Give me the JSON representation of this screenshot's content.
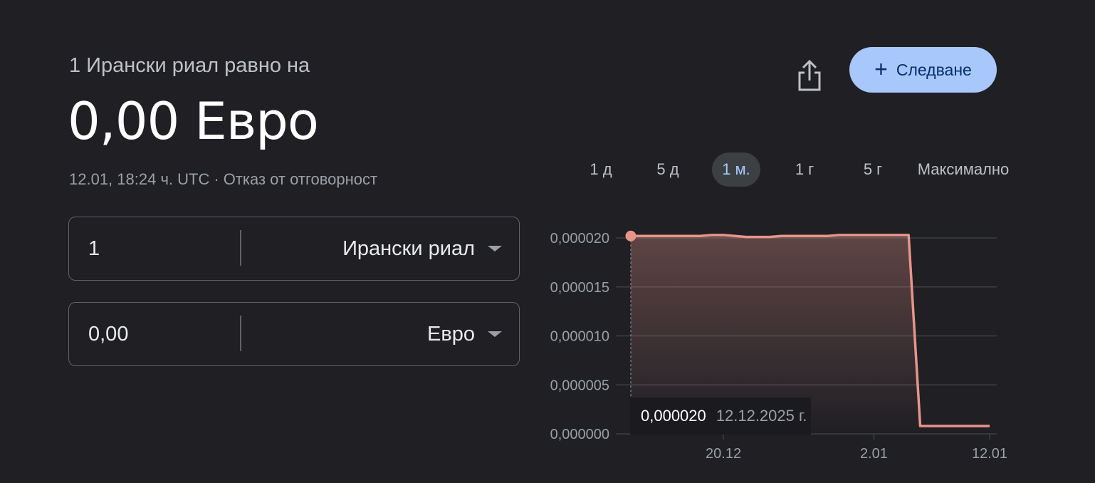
{
  "header": {
    "subtitle": "1 Ирански риал равно на",
    "value": "0,00 Евро",
    "timestamp": "12.01, 18:24 ч. UTC",
    "separator": "·",
    "disclaimer": "Отказ от отговорност"
  },
  "actions": {
    "share_icon": "share-icon",
    "follow_label": "Следване",
    "follow_icon": "plus-icon",
    "follow_bg": "#a8c7fa"
  },
  "converter": {
    "from": {
      "amount": "1",
      "currency": "Ирански риал"
    },
    "to": {
      "amount": "0,00",
      "currency": "Евро"
    }
  },
  "ranges": {
    "items": [
      "1 д",
      "5 д",
      "1 м.",
      "1 г",
      "5 г",
      "Максимално"
    ],
    "active": "1 м."
  },
  "chart_data": {
    "type": "area",
    "line_color": "#e8948a",
    "x": [
      "12.12",
      "13.12",
      "14.12",
      "15.12",
      "16.12",
      "17.12",
      "18.12",
      "19.12",
      "20.12",
      "21.12",
      "22.12",
      "23.12",
      "24.12",
      "25.12",
      "26.12",
      "27.12",
      "28.12",
      "29.12",
      "30.12",
      "31.12",
      "1.01",
      "2.01",
      "3.01",
      "4.01",
      "5.01",
      "6.01",
      "7.01",
      "8.01",
      "9.01",
      "10.01",
      "11.01",
      "12.01"
    ],
    "values": [
      2.02e-05,
      2.02e-05,
      2.02e-05,
      2.02e-05,
      2.02e-05,
      2.02e-05,
      2.02e-05,
      2.03e-05,
      2.03e-05,
      2.02e-05,
      2.01e-05,
      2.01e-05,
      2.01e-05,
      2.02e-05,
      2.02e-05,
      2.02e-05,
      2.02e-05,
      2.02e-05,
      2.03e-05,
      2.03e-05,
      2.03e-05,
      2.03e-05,
      2.03e-05,
      2.03e-05,
      2.03e-05,
      8e-07,
      8e-07,
      8e-07,
      8e-07,
      8e-07,
      8e-07,
      8e-07
    ],
    "ylim": [
      0,
      2e-05
    ],
    "y_ticks": [
      "0,000020",
      "0,000015",
      "0,000010",
      "0,000005",
      "0,000000"
    ],
    "x_ticks": [
      "20.12",
      "2.01",
      "12.01"
    ],
    "grid": true,
    "tooltip": {
      "value": "0,000020",
      "date": "12.12.2025 г."
    }
  }
}
